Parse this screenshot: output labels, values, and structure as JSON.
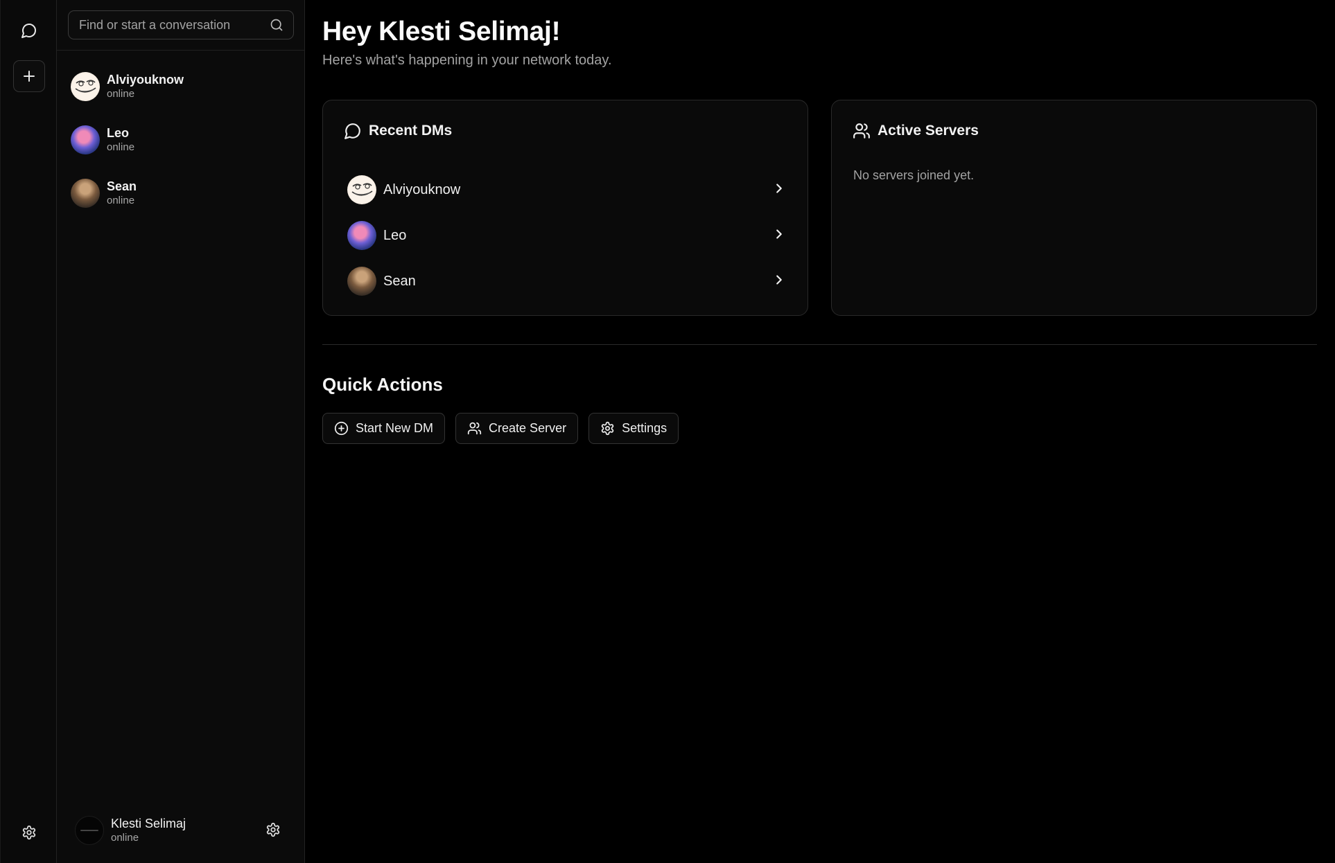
{
  "search": {
    "placeholder": "Find or start a conversation"
  },
  "conversations": [
    {
      "name": "Alviyouknow",
      "status": "online"
    },
    {
      "name": "Leo",
      "status": "online"
    },
    {
      "name": "Sean",
      "status": "online"
    }
  ],
  "current_user": {
    "name": "Klesti Selimaj",
    "status": "online"
  },
  "main": {
    "title": "Hey Klesti Selimaj!",
    "subtitle": "Here's what's happening in your network today.",
    "recent_dms": {
      "title": "Recent DMs",
      "items": [
        {
          "name": "Alviyouknow"
        },
        {
          "name": "Leo"
        },
        {
          "name": "Sean"
        }
      ]
    },
    "active_servers": {
      "title": "Active Servers",
      "empty_text": "No servers joined yet."
    },
    "quick_actions": {
      "title": "Quick Actions",
      "start_dm": "Start New DM",
      "create_server": "Create Server",
      "settings": "Settings"
    }
  },
  "icons": {
    "rail_top": "message-circle-icon",
    "rail_add": "plus-icon",
    "rail_bottom": "gear-icon",
    "search": "search-icon",
    "chevron": "chevron-right-icon"
  }
}
